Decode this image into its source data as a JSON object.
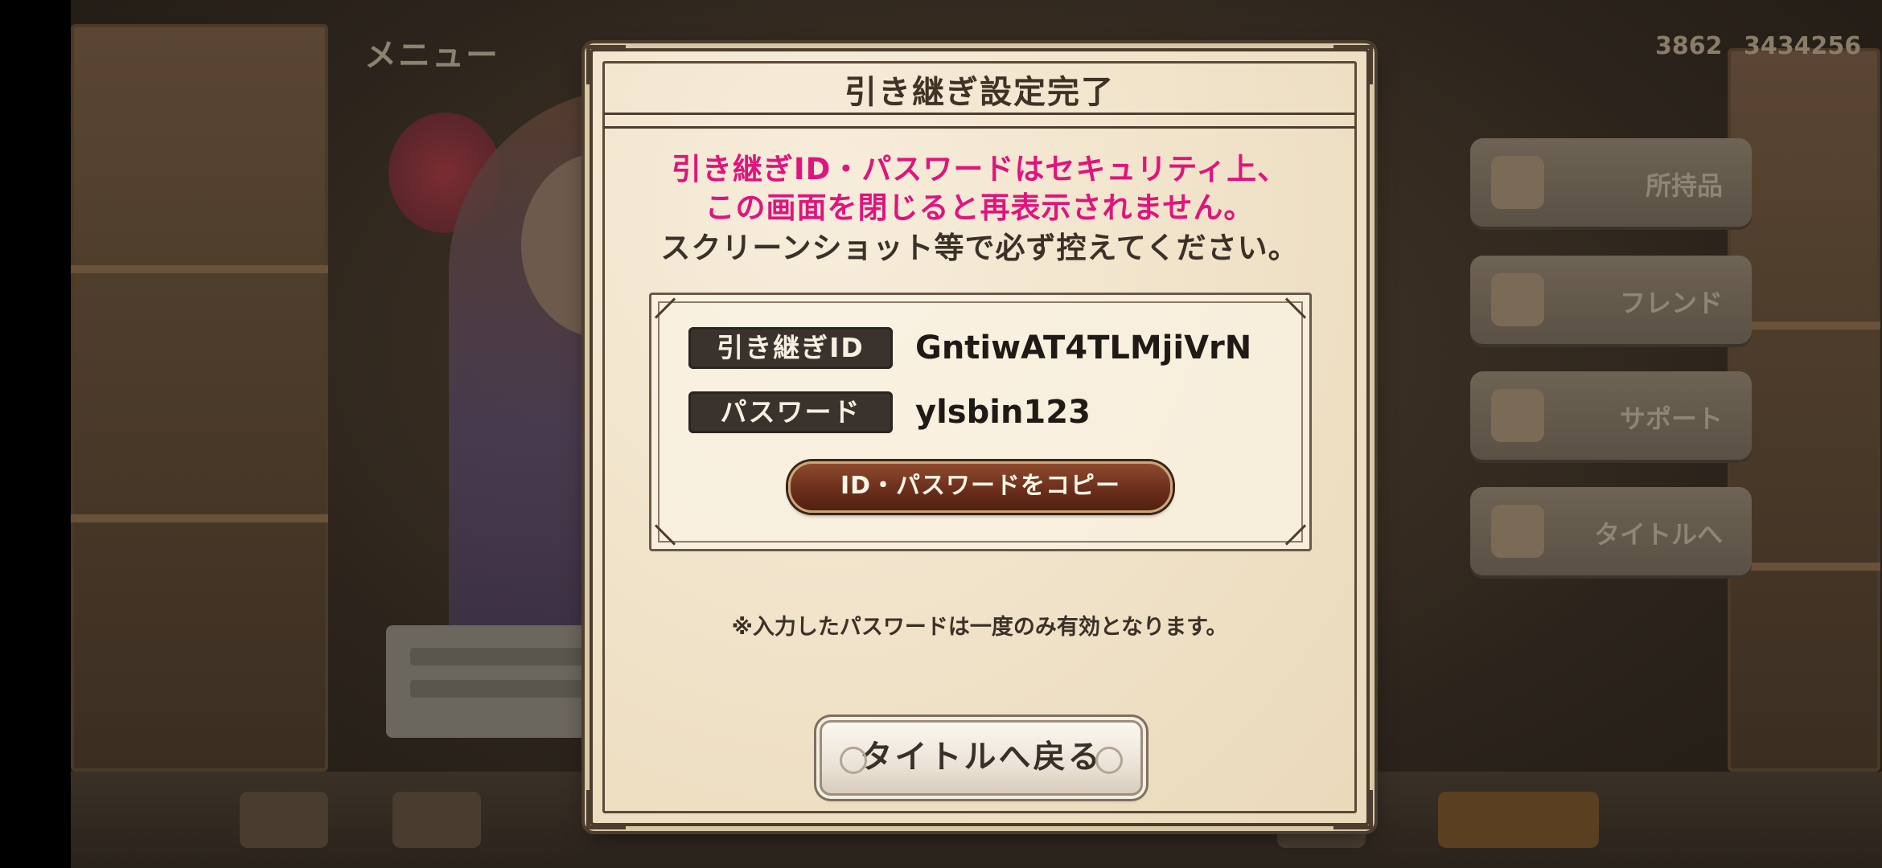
{
  "background": {
    "menu_label": "メニュー",
    "counter_1": "3862",
    "counter_2": "3434256",
    "side_buttons": [
      "所持品",
      "フレンド",
      "サポート",
      "タイトルへ"
    ]
  },
  "dialog": {
    "title": "引き継ぎ設定完了",
    "warning_line_1": "引き継ぎID・パスワードはセキュリティ上、",
    "warning_line_2": "この画面を閉じると再表示されません。",
    "warning_line_3": "スクリーンショット等で必ず控えてください。",
    "id_label": "引き継ぎID",
    "id_value": "GntiwAT4TLMjiVrN",
    "password_label": "パスワード",
    "password_value": "ylsbin123",
    "copy_button": "ID・パスワードをコピー",
    "note": "※入力したパスワードは一度のみ有効となります。",
    "return_button": "タイトルへ戻る"
  },
  "colors": {
    "warning": "#e0147e",
    "parchment": "#f1e4cb",
    "frame": "#4c3d2e",
    "label_bg": "#3a332d",
    "copy_button": "#6c2f1c"
  }
}
